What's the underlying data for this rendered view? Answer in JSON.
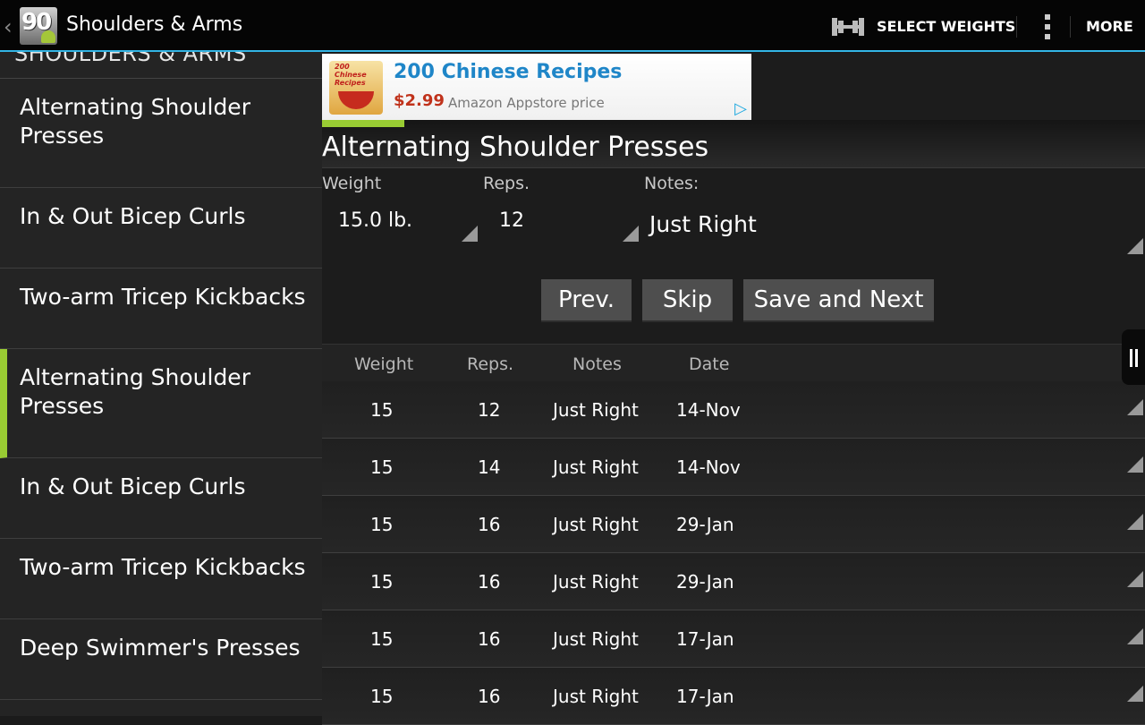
{
  "actionbar": {
    "app_icon_text": "90",
    "title": "Shoulders & Arms",
    "select_weights_label": "SELECT WEIGHTS",
    "more_label": "MORE",
    "accent_color": "#33b5e5"
  },
  "sidebar": {
    "header": "SHOULDERS & ARMS",
    "selected_color": "#99cc33",
    "items": [
      {
        "label": "Alternating Shoulder Presses"
      },
      {
        "label": "In & Out Bicep Curls"
      },
      {
        "label": "Two-arm Tricep Kickbacks"
      },
      {
        "label": "Alternating Shoulder Presses"
      },
      {
        "label": "In & Out Bicep Curls"
      },
      {
        "label": "Two-arm Tricep Kickbacks"
      },
      {
        "label": "Deep Swimmer's Presses"
      }
    ]
  },
  "ad": {
    "thumb_text": "200 Chinese Recipes",
    "title": "200 Chinese Recipes",
    "price": "$2.99",
    "subtitle": "Amazon Appstore price"
  },
  "exercise": {
    "title": "Alternating Shoulder Presses",
    "weight_label": "Weight",
    "reps_label": "Reps.",
    "notes_label": "Notes:",
    "weight_value": "15.0 lb.",
    "reps_value": "12",
    "notes_value": "Just Right"
  },
  "buttons": {
    "prev": "Prev.",
    "skip": "Skip",
    "save_next": "Save and Next"
  },
  "history": {
    "columns": [
      "Weight",
      "Reps.",
      "Notes",
      "Date"
    ],
    "rows": [
      {
        "weight": "15",
        "reps": "12",
        "notes": "Just Right",
        "date": "14-Nov"
      },
      {
        "weight": "15",
        "reps": "14",
        "notes": "Just Right",
        "date": "14-Nov"
      },
      {
        "weight": "15",
        "reps": "16",
        "notes": "Just Right",
        "date": "29-Jan"
      },
      {
        "weight": "15",
        "reps": "16",
        "notes": "Just Right",
        "date": "29-Jan"
      },
      {
        "weight": "15",
        "reps": "16",
        "notes": "Just Right",
        "date": "17-Jan"
      },
      {
        "weight": "15",
        "reps": "16",
        "notes": "Just Right",
        "date": "17-Jan"
      }
    ]
  }
}
